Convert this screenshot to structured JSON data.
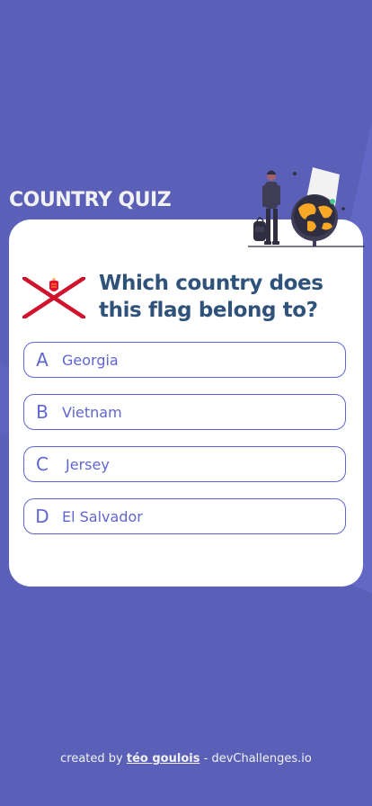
{
  "app": {
    "title": "COUNTRY QUIZ"
  },
  "quiz": {
    "question": "Which country does this flag belong to?",
    "flag_icon": "jersey-flag",
    "options": [
      {
        "letter": "A",
        "text": "Georgia"
      },
      {
        "letter": "B",
        "text": "Vietnam"
      },
      {
        "letter": "C",
        "text": "Jersey"
      },
      {
        "letter": "D",
        "text": "El Salvador"
      }
    ]
  },
  "footer": {
    "prefix": "created by",
    "author": "téo goulois",
    "separator": "-",
    "site": "devChallenges.io"
  },
  "colors": {
    "background": "#5a5fb8",
    "card": "#ffffff",
    "question_text": "#2f527b",
    "option_accent": "#6066d0",
    "title": "#f2f2f2"
  }
}
